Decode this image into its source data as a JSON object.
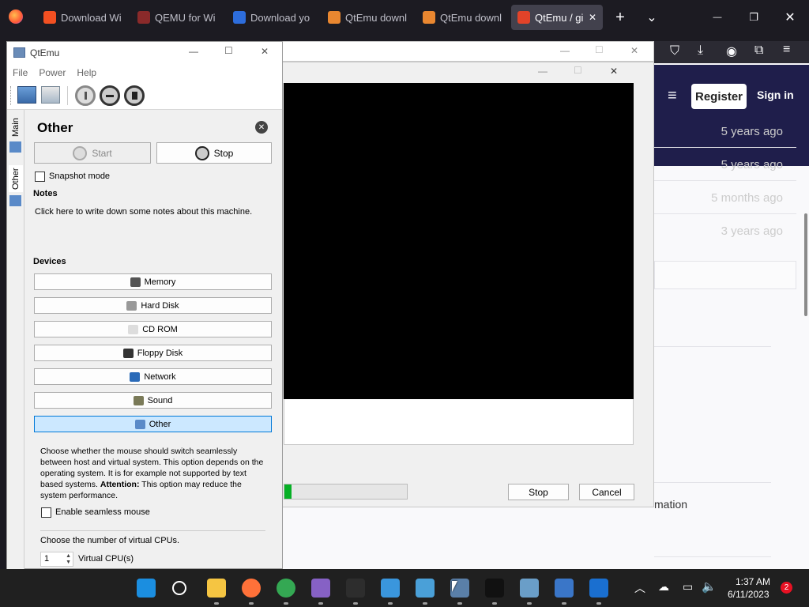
{
  "browser": {
    "tabs": [
      {
        "label": "Download Wi",
        "color": "#f25022"
      },
      {
        "label": "QEMU for Wi",
        "color": "#8a2a2a"
      },
      {
        "label": "Download yo",
        "color": "#2d6ddc"
      },
      {
        "label": "QtEmu downl",
        "color": "#e98730"
      },
      {
        "label": "QtEmu downl",
        "color": "#e98730"
      },
      {
        "label": "QtEmu / gi",
        "color": "#e24329",
        "active": true
      }
    ],
    "new_tab": "+",
    "list_tabs": "⌄",
    "minimize": "—",
    "maximize": "❐",
    "close": "✕",
    "close_tab": "✕"
  },
  "webpage": {
    "register": "Register",
    "sign_in": "Sign in",
    "times": [
      "5 years ago",
      "5 years ago",
      "5 months ago",
      "3 years ago"
    ],
    "partial_text": "mation"
  },
  "dialog": {
    "stop": "Stop",
    "cancel": "Cancel",
    "progress": 0.06
  },
  "qtemu": {
    "title": "QtEmu",
    "menu": [
      "File",
      "Power",
      "Help"
    ],
    "side_tabs": [
      "Main",
      "Other"
    ],
    "panel_title": "Other",
    "start": "Start",
    "stop": "Stop",
    "snapshot_mode": "Snapshot mode",
    "notes_heading": "Notes",
    "notes_text": "Click here to write down some notes about this machine.",
    "devices_heading": "Devices",
    "devices": [
      {
        "label": "Memory",
        "icon": "memory-icon",
        "color": "#555"
      },
      {
        "label": "Hard Disk",
        "icon": "hard-disk-icon",
        "color": "#999"
      },
      {
        "label": "CD ROM",
        "icon": "cd-rom-icon",
        "color": "#ddd"
      },
      {
        "label": "Floppy Disk",
        "icon": "floppy-disk-icon",
        "color": "#333"
      },
      {
        "label": "Network",
        "icon": "network-icon",
        "color": "#2a6ab8"
      },
      {
        "label": "Sound",
        "icon": "sound-icon",
        "color": "#7a7a58"
      },
      {
        "label": "Other",
        "icon": "computer-icon",
        "color": "#5a8ac8",
        "selected": true
      }
    ],
    "desc_lead": "Choose whether the mouse should switch seamlessly between host and virtual system. This option depends on the operating system. It is for example not supported by text based systems.",
    "desc_attention": "Attention:",
    "desc_tail": " This option may reduce the system performance.",
    "seamless_mouse": "Enable seamless mouse",
    "cpu_prompt": "Choose the number of virtual CPUs.",
    "cpu_value": "1",
    "cpu_label": "Virtual CPU(s)"
  },
  "taskbar": {
    "time": "1:37 AM",
    "date": "6/11/2023",
    "notification_count": "2",
    "apps": [
      {
        "name": "start",
        "color": "#1b8ee0"
      },
      {
        "name": "search",
        "color": "#202020"
      },
      {
        "name": "file-explorer",
        "color": "#f5c542"
      },
      {
        "name": "firefox",
        "color": "#ff7139"
      },
      {
        "name": "chrome",
        "color": "#34a853"
      },
      {
        "name": "visual-studio",
        "color": "#8661c5"
      },
      {
        "name": "terminal",
        "color": "#2d2d2d"
      },
      {
        "name": "control-panel",
        "color": "#3a96dd"
      },
      {
        "name": "network-app",
        "color": "#4aa0d8"
      },
      {
        "name": "qtemu",
        "color": "#5a7fa8"
      },
      {
        "name": "console",
        "color": "#111111"
      },
      {
        "name": "photos",
        "color": "#6a9ec8"
      },
      {
        "name": "remote-desktop",
        "color": "#3a76c8"
      },
      {
        "name": "app-window",
        "color": "#1a6fd0"
      }
    ]
  }
}
